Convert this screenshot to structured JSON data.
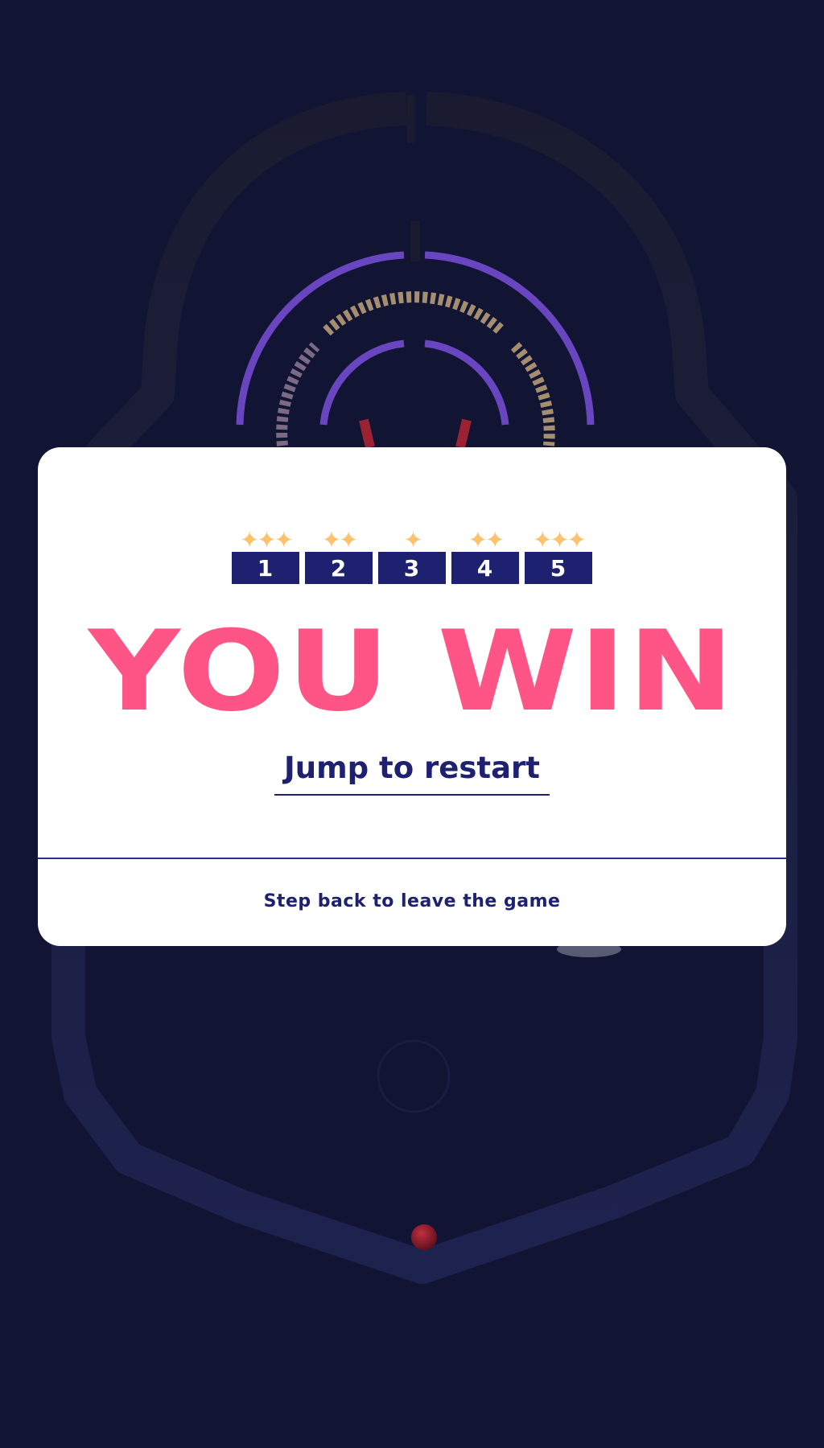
{
  "colors": {
    "background": "#111432",
    "card": "#ffffff",
    "title": "#ff5586",
    "navy": "#1d2170",
    "star": "#fcc26c",
    "ring": "#6a45c0"
  },
  "levels": [
    {
      "number": "1",
      "stars": "✦✦✦",
      "star_count": 3
    },
    {
      "number": "2",
      "stars": "✦✦",
      "star_count": 2
    },
    {
      "number": "3",
      "stars": "✦",
      "star_count": 1
    },
    {
      "number": "4",
      "stars": "✦✦",
      "star_count": 2
    },
    {
      "number": "5",
      "stars": "✦✦✦",
      "star_count": 3
    }
  ],
  "result_title": "YOU WIN",
  "restart_label": "Jump to restart",
  "leave_label": "Step back to leave the game"
}
